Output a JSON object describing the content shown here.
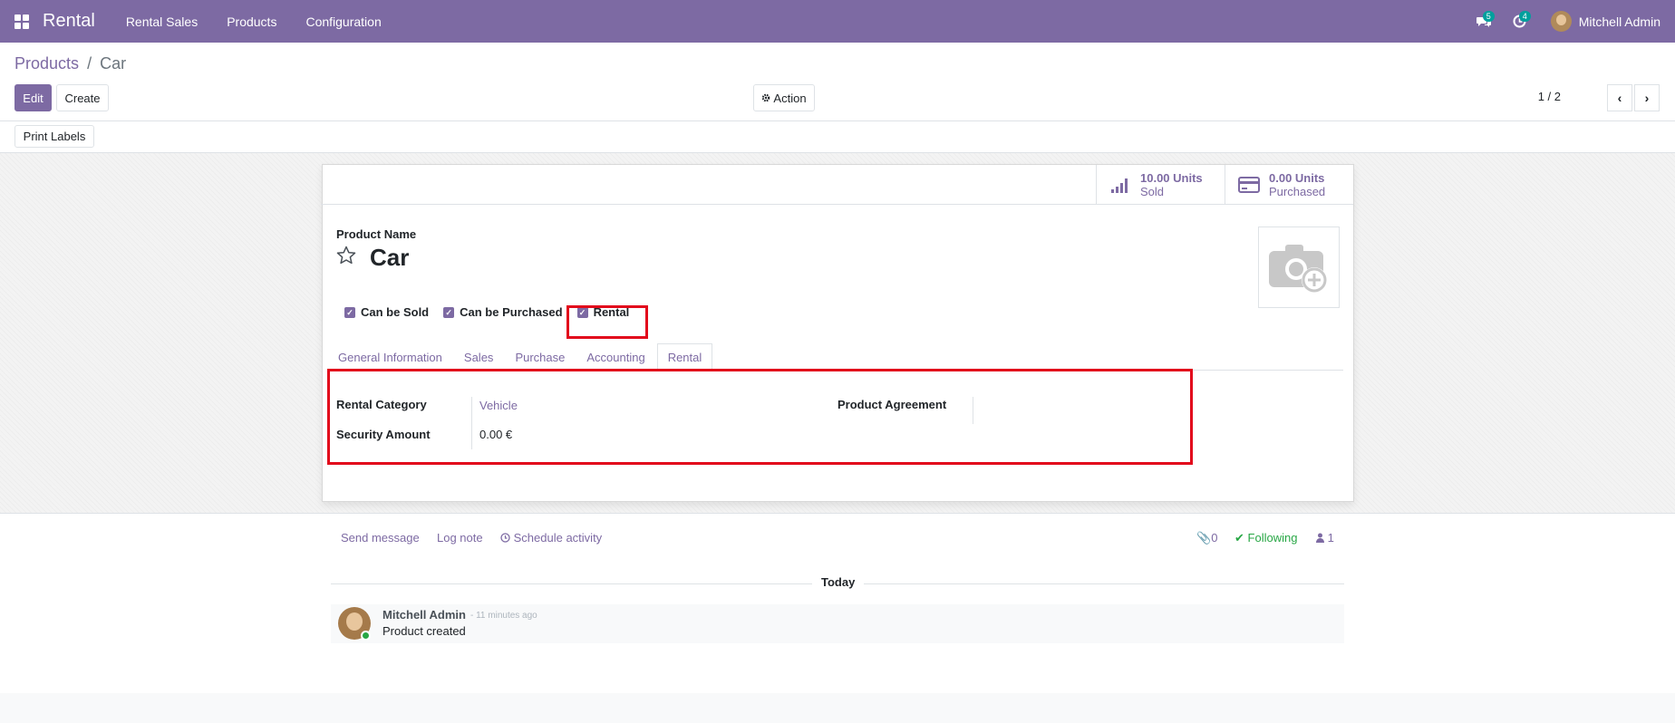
{
  "navbar": {
    "app_title": "Rental",
    "menu": [
      "Rental Sales",
      "Products",
      "Configuration"
    ],
    "messages_badge": "5",
    "activities_badge": "4",
    "user_name": "Mitchell Admin"
  },
  "breadcrumb": {
    "parent": "Products",
    "separator": "/",
    "current": "Car"
  },
  "toolbar": {
    "edit_label": "Edit",
    "create_label": "Create",
    "action_label": "Action",
    "pager_text": "1 / 2",
    "print_labels": "Print Labels"
  },
  "stats": [
    {
      "value": "10.00 Units",
      "label": "Sold",
      "icon": "signal-bars-icon"
    },
    {
      "value": "0.00 Units",
      "label": "Purchased",
      "icon": "credit-card-icon"
    }
  ],
  "product": {
    "name_label": "Product Name",
    "name": "Car",
    "checks": [
      "Can be Sold",
      "Can be Purchased",
      "Rental"
    ]
  },
  "tabs": [
    "General Information",
    "Sales",
    "Purchase",
    "Accounting",
    "Rental"
  ],
  "active_tab": "Rental",
  "rental_tab": {
    "category_label": "Rental Category",
    "category_value": "Vehicle",
    "security_label": "Security Amount",
    "security_value": "0.00 €",
    "agreement_label": "Product Agreement"
  },
  "chatter": {
    "send_message": "Send message",
    "log_note": "Log note",
    "schedule_activity": "Schedule activity",
    "attachments_count": "0",
    "following": "Following",
    "followers_count": "1",
    "date_separator": "Today",
    "message": {
      "author": "Mitchell Admin",
      "time": "- 11 minutes ago",
      "body": "Product created"
    }
  },
  "colors": {
    "brand": "#7d6aa3",
    "highlight": "#e2071b",
    "success": "#28a745"
  }
}
